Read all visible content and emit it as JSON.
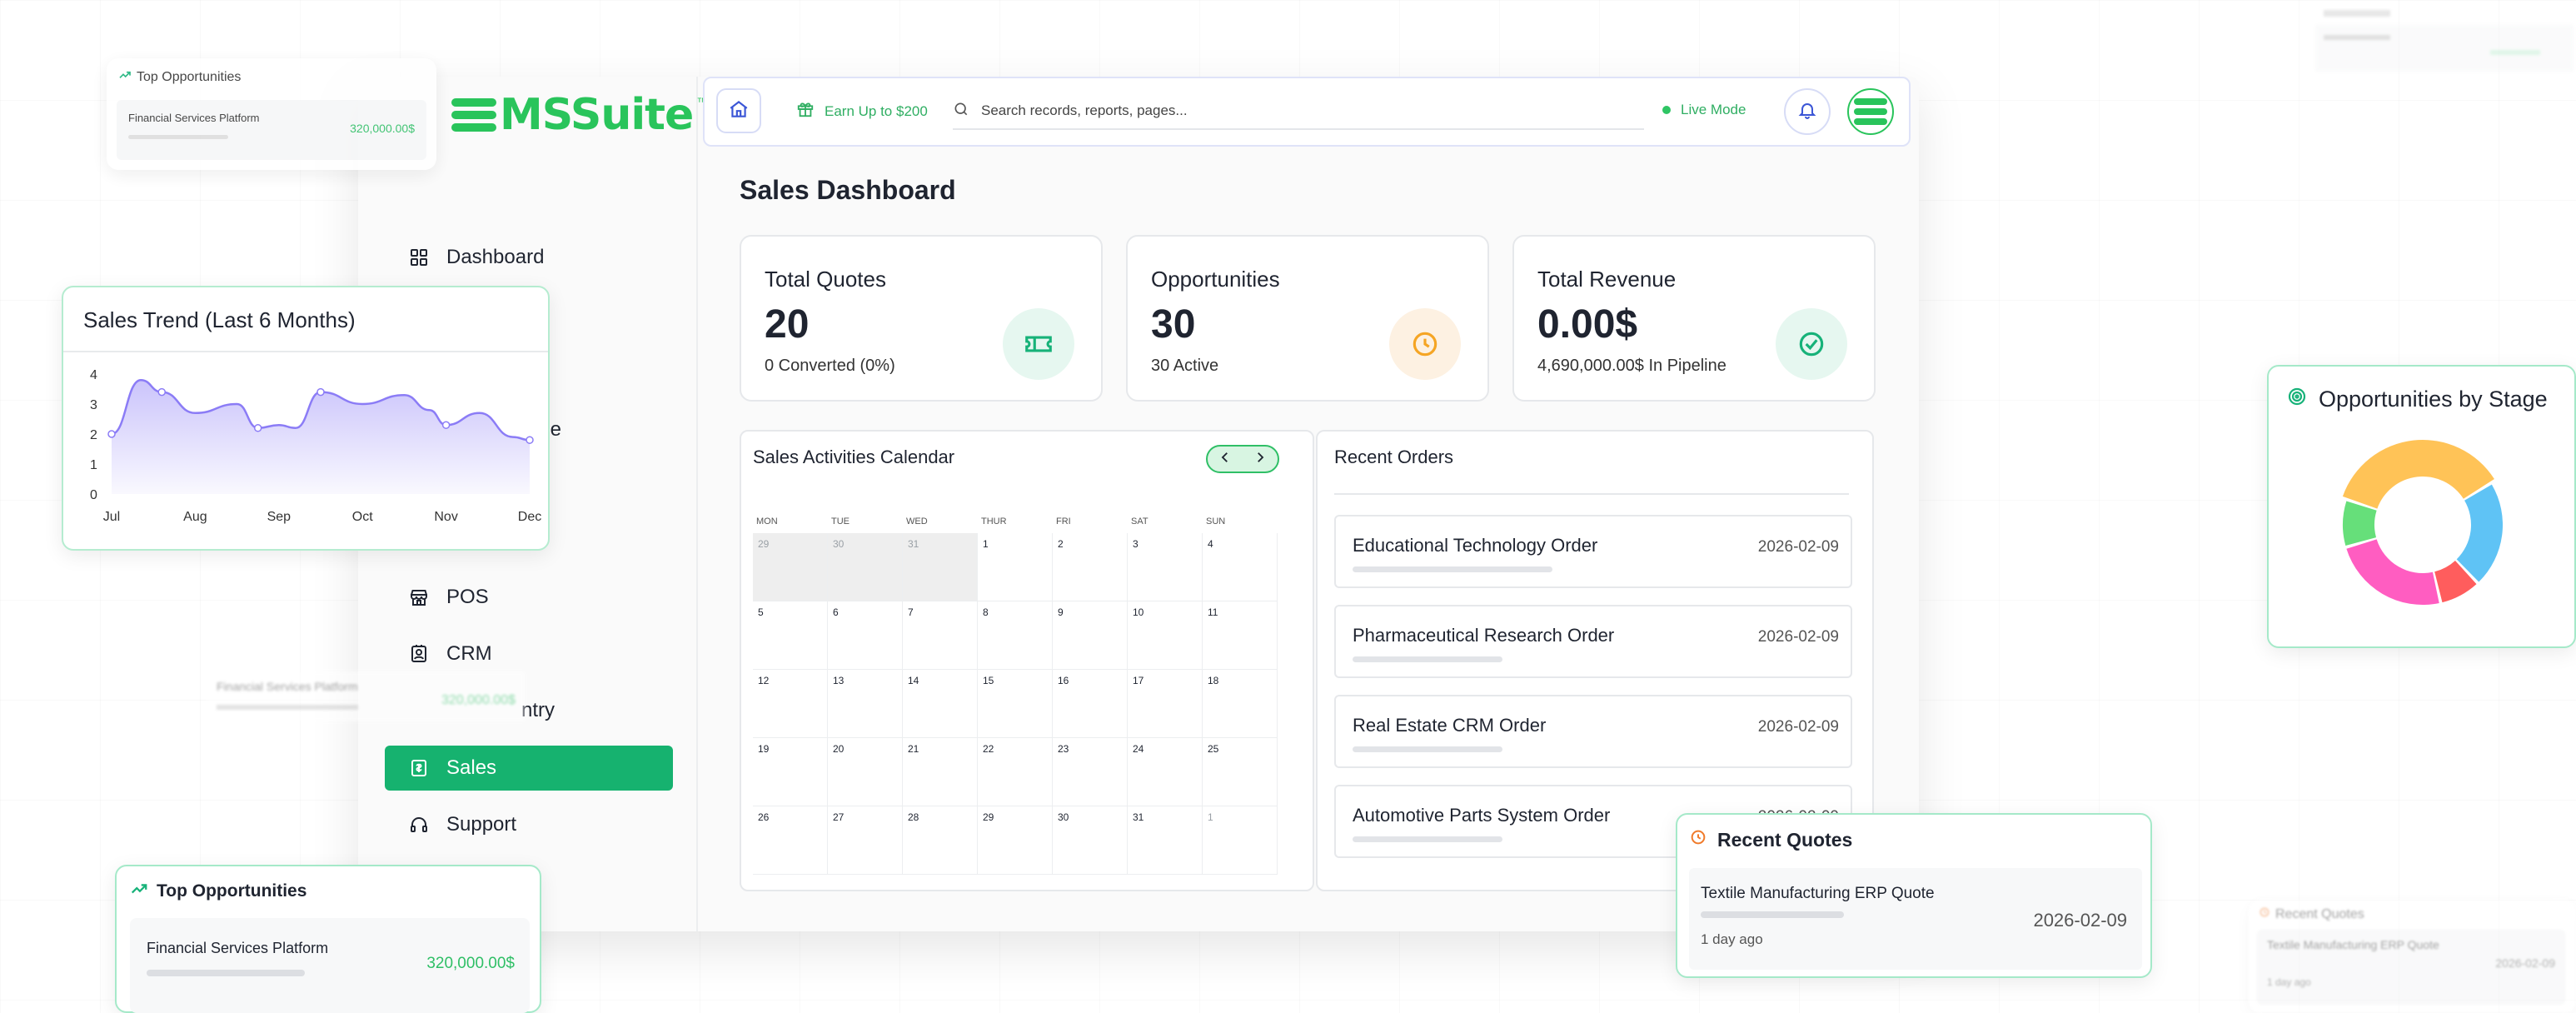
{
  "app": {
    "logo_text": "MSSuite",
    "logo_tm": "™"
  },
  "sidebar": {
    "items": [
      {
        "label": "Dashboard",
        "icon": "grid-icon"
      },
      {
        "label": "ervice",
        "icon": "service-icon"
      },
      {
        "label": "POS",
        "icon": "store-icon"
      },
      {
        "label": "CRM",
        "icon": "contact-icon"
      },
      {
        "label": "ntry",
        "icon": "entry-icon"
      },
      {
        "label": "Sales",
        "icon": "sales-icon",
        "active": true
      },
      {
        "label": "Support",
        "icon": "headset-icon"
      }
    ]
  },
  "topbar": {
    "earn_label": "Earn Up to $200",
    "search_placeholder": "Search records, reports, pages...",
    "live_label": "Live Mode"
  },
  "page": {
    "title": "Sales Dashboard"
  },
  "stats": [
    {
      "label": "Total Quotes",
      "value": "20",
      "sub": "0 Converted (0%)",
      "icon": "ticket-icon",
      "color": "#17b279",
      "bg": "#e6f7f0"
    },
    {
      "label": "Opportunities",
      "value": "30",
      "sub": "30 Active",
      "icon": "clock-icon",
      "color": "#f5a524",
      "bg": "#fdf1e2"
    },
    {
      "label": "Total Revenue",
      "value": "0.00$",
      "sub": "4,690,000.00$ In Pipeline",
      "icon": "check-circle-icon",
      "color": "#17b279",
      "bg": "#e6f7f0"
    }
  ],
  "calendar": {
    "title": "Sales Activities Calendar",
    "weekdays": [
      "MON",
      "TUE",
      "WED",
      "THUR",
      "FRI",
      "SAT",
      "SUN"
    ],
    "weeks": [
      [
        "29",
        "30",
        "31",
        "1",
        "2",
        "3",
        "4"
      ],
      [
        "5",
        "6",
        "7",
        "8",
        "9",
        "10",
        "11"
      ],
      [
        "12",
        "13",
        "14",
        "15",
        "16",
        "17",
        "18"
      ],
      [
        "19",
        "20",
        "21",
        "22",
        "23",
        "24",
        "25"
      ],
      [
        "26",
        "27",
        "28",
        "29",
        "30",
        "31",
        "1"
      ]
    ]
  },
  "orders": {
    "title": "Recent Orders",
    "items": [
      {
        "name": "Educational Technology Order",
        "date": "2026-02-09"
      },
      {
        "name": "Pharmaceutical Research Order",
        "date": "2026-02-09"
      },
      {
        "name": "Real Estate CRM Order",
        "date": "2026-02-09"
      },
      {
        "name": "Automotive Parts System Order",
        "date": "2026-02-09"
      }
    ]
  },
  "top_opp_small": {
    "title": "Top Opportunities",
    "name": "Financial Services Platform",
    "value": "320,000.00$"
  },
  "top_opp": {
    "title": "Top Opportunities",
    "name": "Financial Services Platform",
    "value": "320,000.00$"
  },
  "ghost_row": {
    "name": "Financial Services Platform",
    "value": "320,000.00$"
  },
  "recent_quotes": {
    "title": "Recent Quotes",
    "name": "Textile Manufacturing ERP Quote",
    "time": "1 day ago",
    "date": "2026-02-09"
  },
  "recent_quotes_ghost": {
    "title": "Recent Quotes",
    "name": "Textile Manufacturing ERP Quote",
    "date": "2026-02-09",
    "time": "1 day ago"
  },
  "chart_data": [
    {
      "type": "area",
      "title": "Sales Trend (Last 6 Months)",
      "categories": [
        "Jul",
        "Aug",
        "Sep",
        "Oct",
        "Nov",
        "Dec"
      ],
      "x": [
        0,
        0.35,
        0.6,
        1,
        1.5,
        1.75,
        2,
        2.2,
        2.5,
        3,
        3.5,
        3.8,
        4,
        4.4,
        4.8,
        5
      ],
      "y": [
        2.0,
        3.8,
        3.4,
        2.7,
        3.0,
        2.2,
        2.3,
        2.2,
        3.4,
        3.0,
        3.3,
        2.8,
        2.3,
        2.7,
        1.9,
        1.8
      ],
      "ylim": [
        0,
        4
      ],
      "yticks": [
        "0",
        "1",
        "2",
        "3",
        "4"
      ],
      "color": "#8b7cf6"
    },
    {
      "type": "pie",
      "title": "Opportunities by Stage",
      "values": [
        30,
        18,
        7,
        20,
        8
      ],
      "colors": [
        "#ffc357",
        "#5fc3f5",
        "#ff5d5d",
        "#ff5dc1",
        "#66df7a"
      ],
      "donut": true
    }
  ]
}
